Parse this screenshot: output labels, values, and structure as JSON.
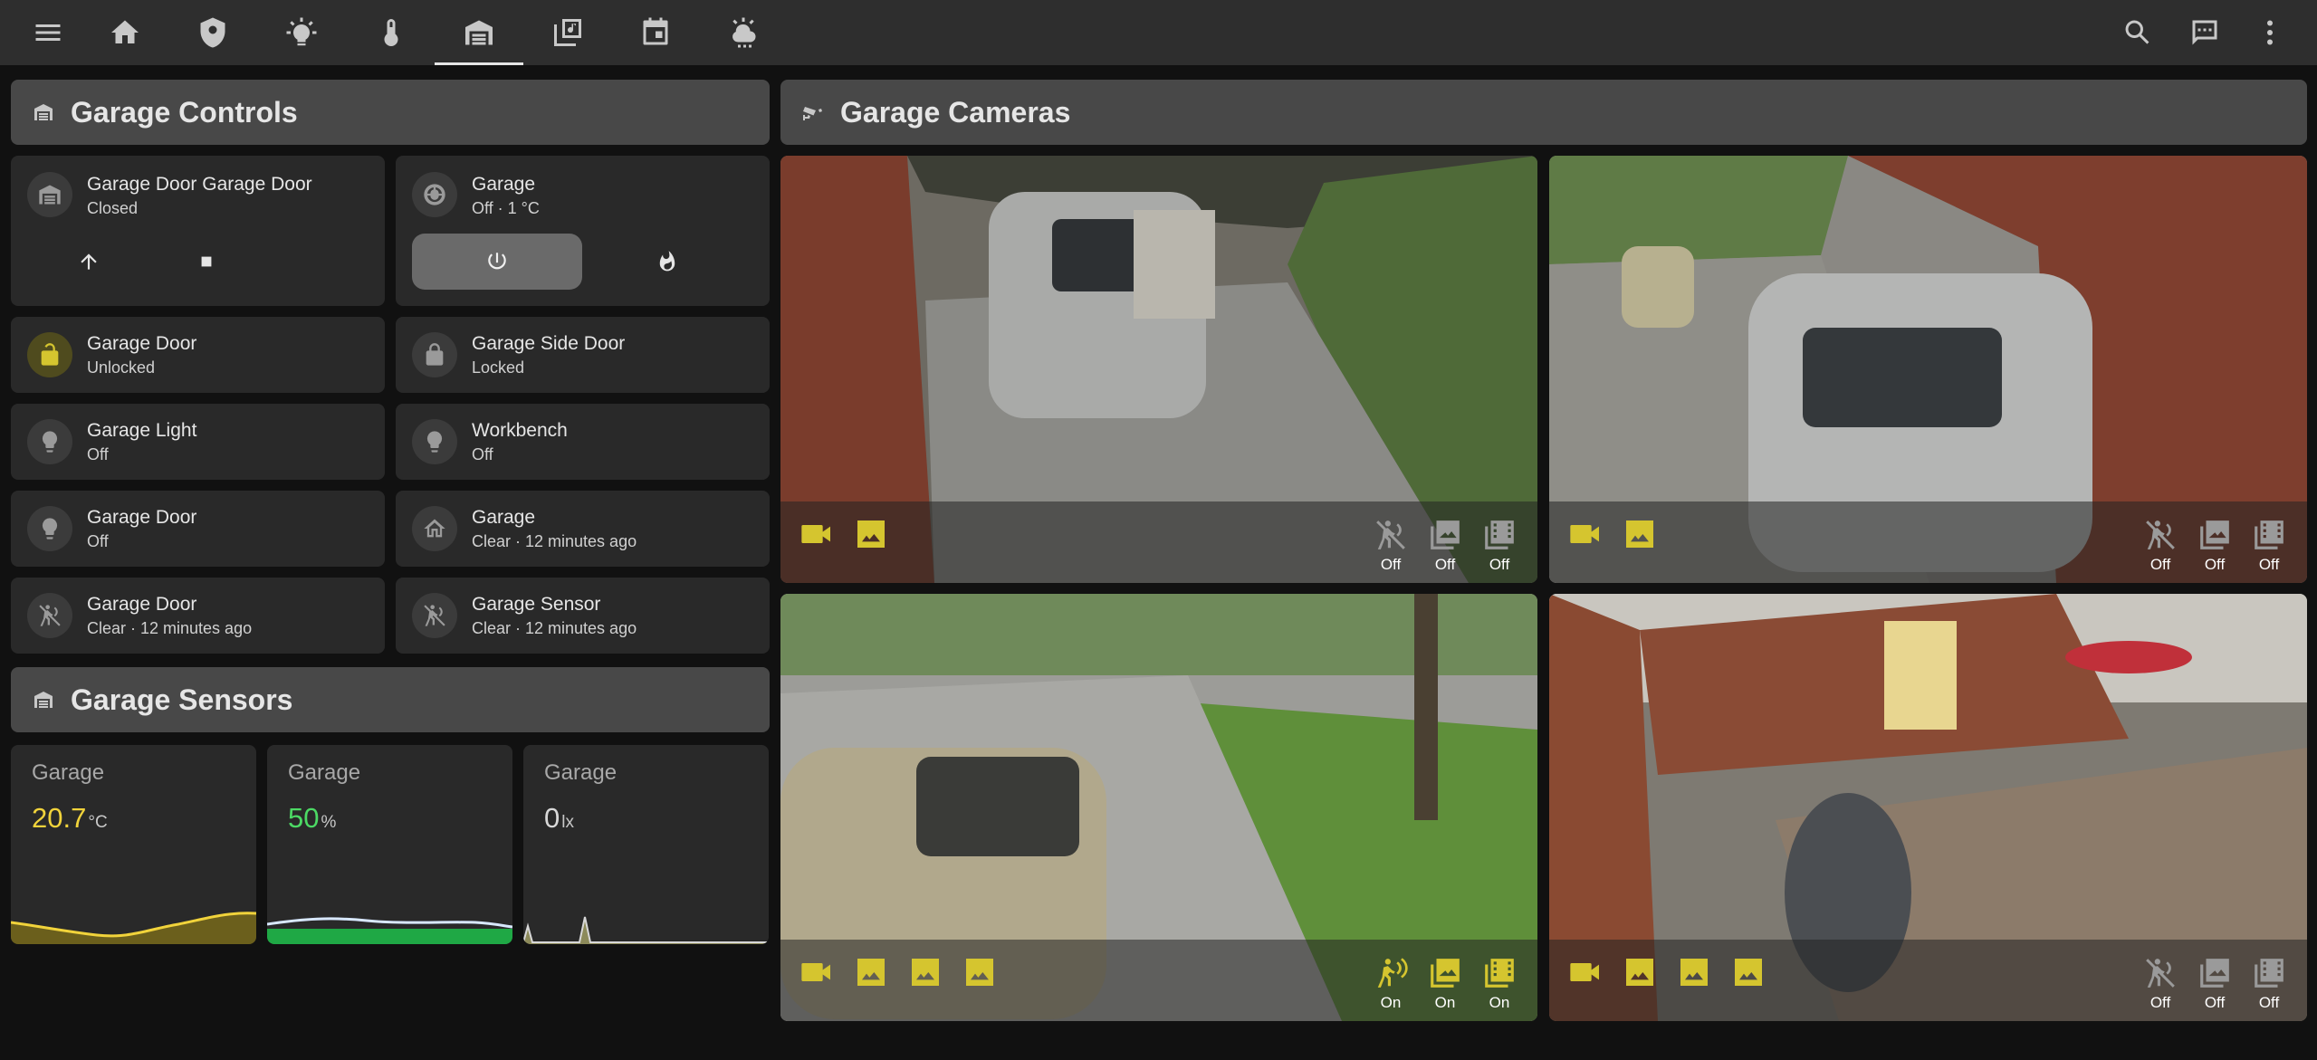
{
  "topbar": {
    "nav_icons": [
      "menu-icon",
      "home-icon",
      "shield-icon",
      "lightbulb-icon",
      "thermometer-icon",
      "garage-icon",
      "music-library-icon",
      "calendar-icon",
      "weather-icon"
    ],
    "active_tab": "garage-icon",
    "right_icons": [
      "search-icon",
      "assist-icon",
      "more-vertical-icon"
    ]
  },
  "controls": {
    "title": "Garage Controls",
    "tiles": [
      {
        "name": "Garage Door Garage Door",
        "state": "Closed"
      },
      {
        "name": "Garage",
        "state": "Off · 1 °C"
      },
      {
        "name": "Garage Door",
        "state": "Unlocked"
      },
      {
        "name": "Garage Side Door",
        "state": "Locked"
      },
      {
        "name": "Garage Light",
        "state": "Off"
      },
      {
        "name": "Workbench",
        "state": "Off"
      },
      {
        "name": "Garage Door",
        "state": "Off"
      },
      {
        "name": "Garage",
        "state": "Clear · 12 minutes ago"
      },
      {
        "name": "Garage Door",
        "state": "Clear · 12 minutes ago"
      },
      {
        "name": "Garage Sensor",
        "state": "Clear · 12 minutes ago"
      }
    ]
  },
  "sensors": {
    "title": "Garage Sensors",
    "cards": [
      {
        "name": "Garage",
        "value": "20.7",
        "unit": "°C",
        "color": "#f1d33b"
      },
      {
        "name": "Garage",
        "value": "50",
        "unit": "%",
        "color": "#4cd964"
      },
      {
        "name": "Garage",
        "value": "0",
        "unit": "lx",
        "color": "#d8d8d8"
      }
    ]
  },
  "cameras": {
    "title": "Garage Cameras",
    "items": [
      {
        "labels": [
          "Off",
          "Off",
          "Off"
        ]
      },
      {
        "labels": [
          "Off",
          "Off",
          "Off"
        ]
      },
      {
        "labels": [
          "On",
          "On",
          "On"
        ]
      },
      {
        "labels": [
          "Off",
          "Off",
          "Off"
        ]
      }
    ]
  },
  "colors": {
    "active_yellow": "#d5c52f",
    "bar": "#2e2e2e",
    "card": "#292929",
    "header": "#484848"
  }
}
